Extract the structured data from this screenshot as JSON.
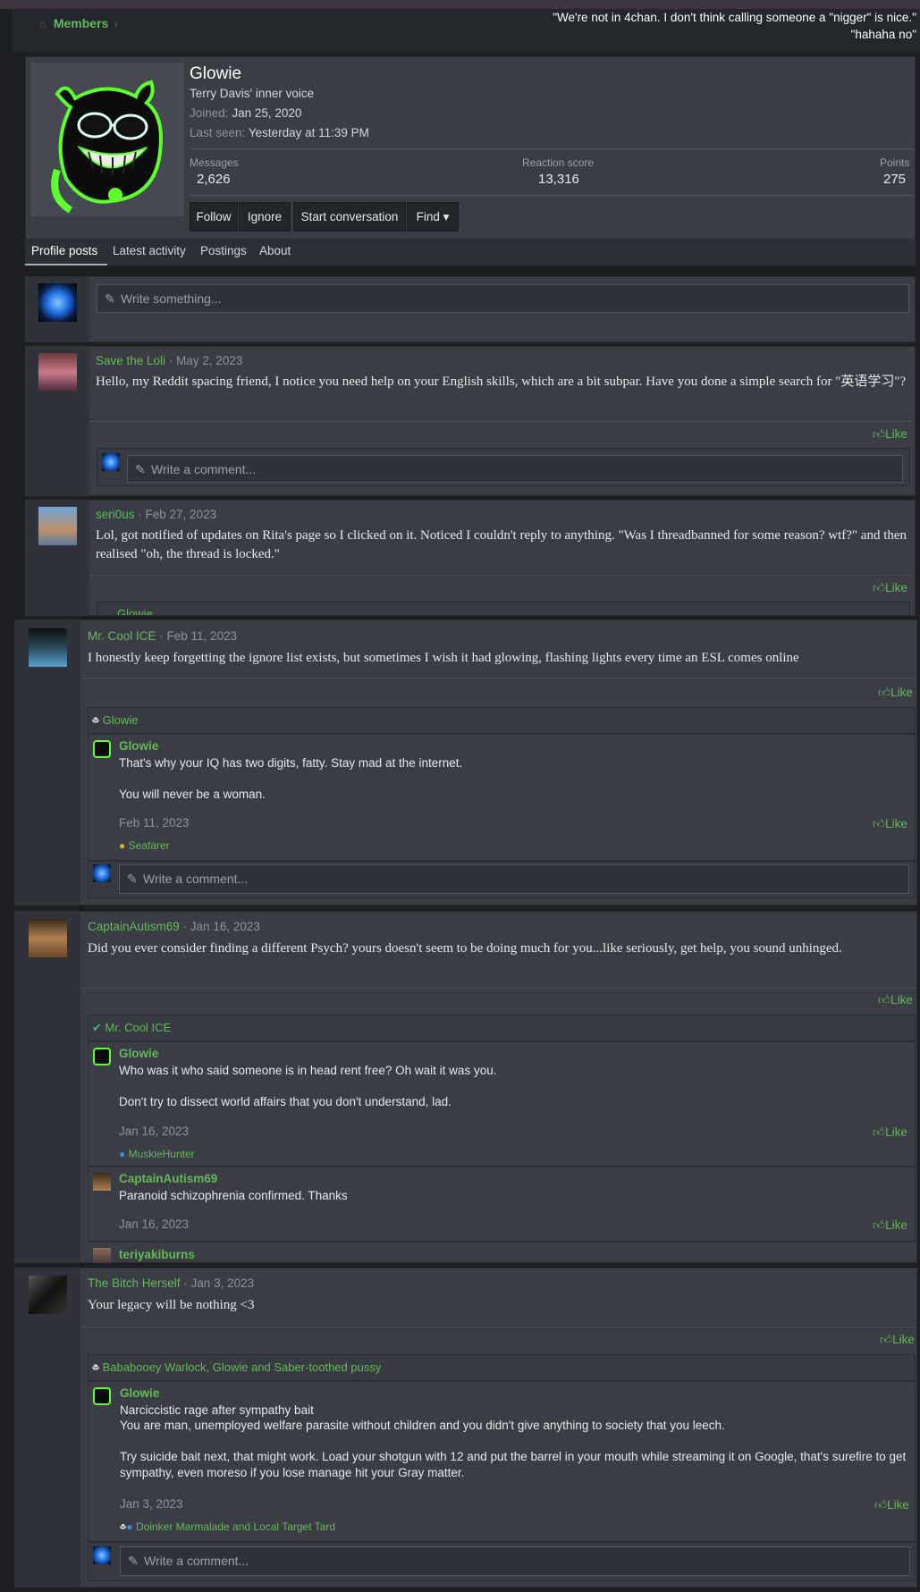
{
  "breadcrumb": {
    "label": "Members"
  },
  "banner_quote": {
    "line1": "\"We're not in 4chan. I don't think calling someone a \"nigger\" is nice.\"",
    "line2": "\"hahaha no\""
  },
  "profile": {
    "name": "Glowie",
    "title": "Terry Davis' inner voice",
    "joined_label": "Joined:",
    "joined_value": "Jan 25, 2020",
    "seen_label": "Last seen:",
    "seen_value": "Yesterday at 11:39 PM",
    "stats": {
      "messages_label": "Messages",
      "messages_value": "2,626",
      "reaction_label": "Reaction score",
      "reaction_value": "13,316",
      "points_label": "Points",
      "points_value": "275"
    },
    "buttons": {
      "follow": "Follow",
      "ignore": "Ignore",
      "start": "Start conversation",
      "find": "Find"
    }
  },
  "tabs": [
    "Profile posts",
    "Latest activity",
    "Postings",
    "About"
  ],
  "write_placeholder": "Write something...",
  "comment_placeholder": "Write a comment...",
  "like_label": "Like",
  "posts": [
    {
      "author": "Save the Loli",
      "date": "May 2, 2023",
      "text": "Hello, my Reddit spacing friend, I notice you need help on your English skills, which are a bit subpar. Have you done a simple search for \"英语学习\"?"
    },
    {
      "author": "seri0us",
      "date": "Feb 27, 2023",
      "text": "Lol, got notified of updates on Rita's page so I clicked on it. Noticed I couldn't reply to anything. \"Was I threadbanned for some reason? wtf?\" and then realised \"oh, the thread is locked.\"",
      "cut_reaction": "Glowie"
    },
    {
      "author": "Mr. Cool ICE",
      "date": "Feb 11, 2023",
      "text": "I honestly keep forgetting the ignore list exists, but sometimes I wish it had glowing, flashing lights every time an ESL comes online",
      "reactors": "Glowie",
      "comments": [
        {
          "author": "Glowie",
          "line1": "That's why your IQ has two digits, fatty. Stay mad at the internet.",
          "line2": "You will never be a woman.",
          "date": "Feb 11, 2023",
          "reactor": "Seafarer"
        }
      ]
    },
    {
      "author": "CaptainAutism69",
      "date": "Jan 16, 2023",
      "text": "Did you ever consider finding a different Psych? yours doesn't seem to be doing much for you...like seriously, get help, you sound unhinged.",
      "reactors": "Mr. Cool ICE",
      "comments": [
        {
          "author": "Glowie",
          "line1": "Who was it who said someone is in head rent free? Oh wait it was you.",
          "line2": "Don't try to dissect world affairs that you don't understand, lad.",
          "date": "Jan 16, 2023",
          "reactor": "MuskieHunter"
        },
        {
          "author": "CaptainAutism69",
          "line1": "Paranoid schizophrenia confirmed. Thanks",
          "date": "Jan 16, 2023"
        },
        {
          "author": "teriyakiburns"
        }
      ]
    },
    {
      "author": "The Bitch Herself",
      "date": "Jan 3, 2023",
      "text": "Your legacy will be nothing <3",
      "reactors": "Bababooey Warlock, Glowie and Saber-toothed pussy",
      "comments": [
        {
          "author": "Glowie",
          "line1": "Narciccistic rage after sympathy bait",
          "line2": "You are man, unemployed welfare parasite without children and you didn't give anything to society that you leech.",
          "line3": "Try suicide bait next, that might work. Load your shotgun with 12 and put the barrel in your mouth while streaming it on Google, that's surefire to get sympathy, even moreso if you lose manage hit your Gray matter.",
          "date": "Jan 3, 2023",
          "reactor": "Doinker Marmalade and Local Target Tard"
        }
      ]
    }
  ],
  "colors": {
    "accent": "#65b85a",
    "card": "#3a3d44",
    "background": "#1d1e22"
  }
}
